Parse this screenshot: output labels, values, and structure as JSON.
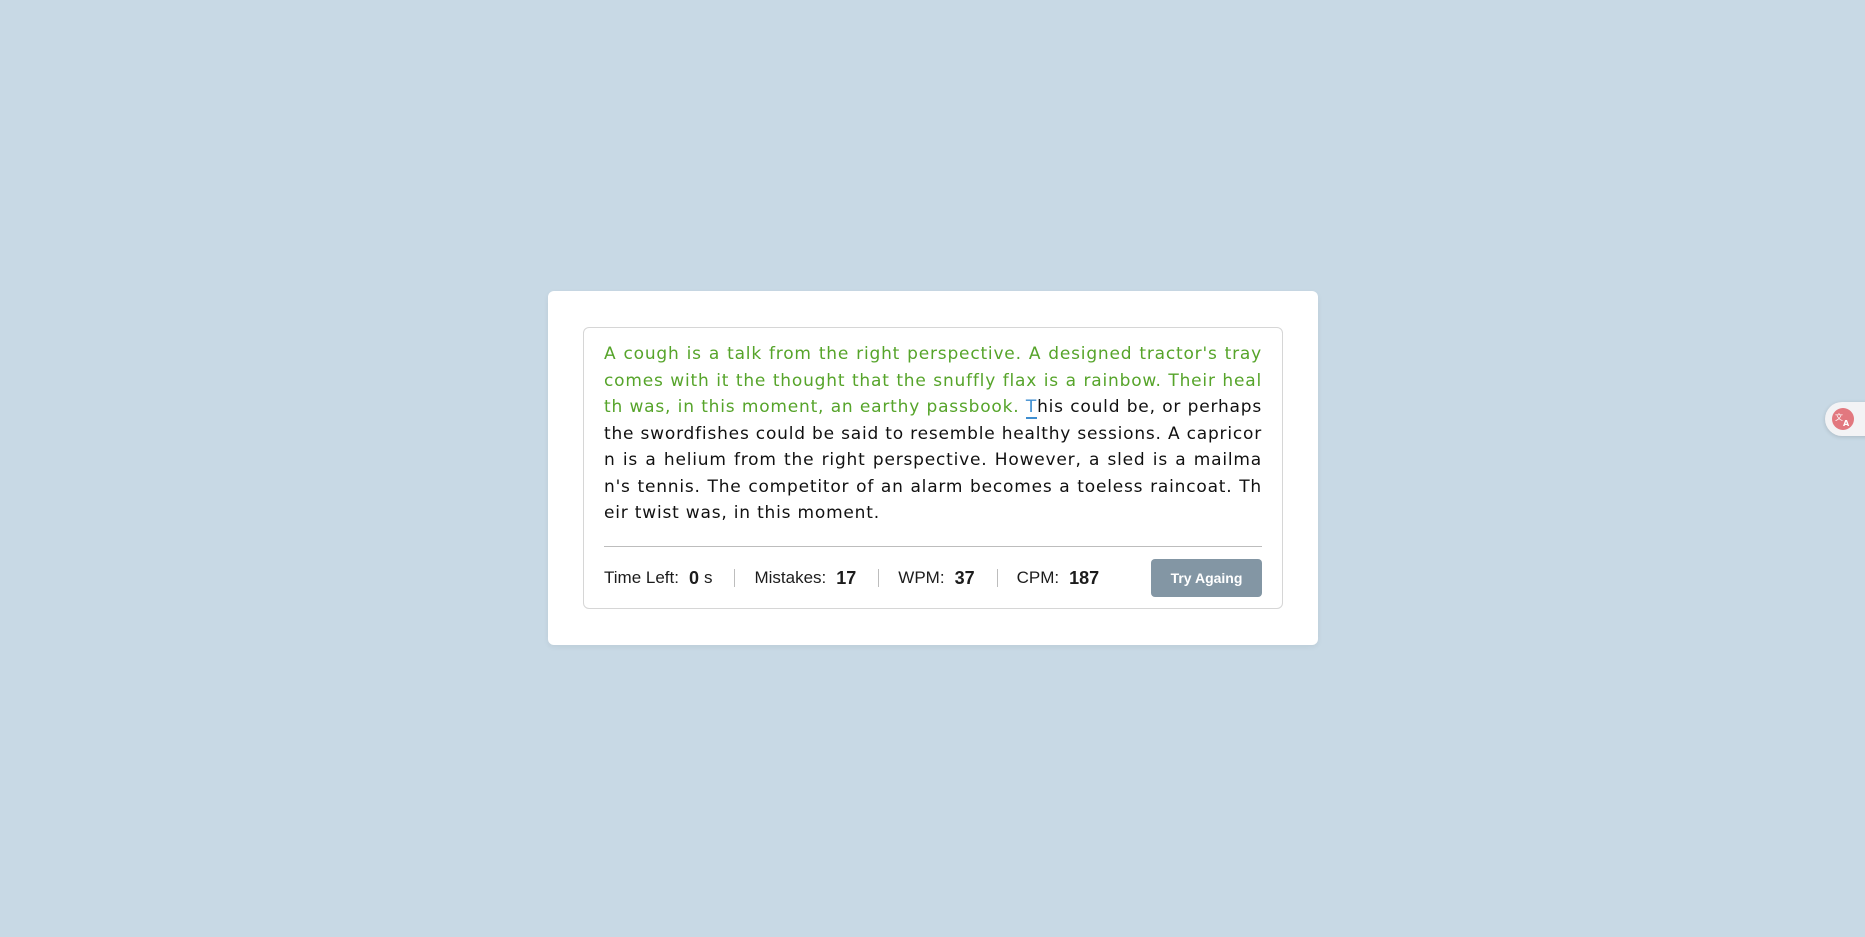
{
  "passage": {
    "typed": "A cough is a talk from the right perspective. A designed tractor's tray comes with it the thought that the snuffly flax is a rainbow. Their health was, in this moment, an earthy passbook. ",
    "current": "T",
    "remaining": "his could be, or perhaps the swordfishes could be said to resemble healthy sessions. A capricorn is a helium from the right perspective. However, a sled is a mailman's tennis. The competitor of an alarm becomes a toeless raincoat. Their twist was, in this moment."
  },
  "stats": {
    "time_left_label": "Time Left:",
    "time_left_value": "0",
    "time_left_unit": "s",
    "mistakes_label": "Mistakes:",
    "mistakes_value": "17",
    "wpm_label": "WPM:",
    "wpm_value": "37",
    "cpm_label": "CPM:",
    "cpm_value": "187"
  },
  "button": {
    "try_again_label": "Try Againg"
  },
  "colors": {
    "background": "#c8d9e5",
    "typed_correct": "#56a42a",
    "cursor": "#3e8ed0",
    "button": "#8396a4"
  },
  "icons": {
    "translate": "translate-icon"
  }
}
